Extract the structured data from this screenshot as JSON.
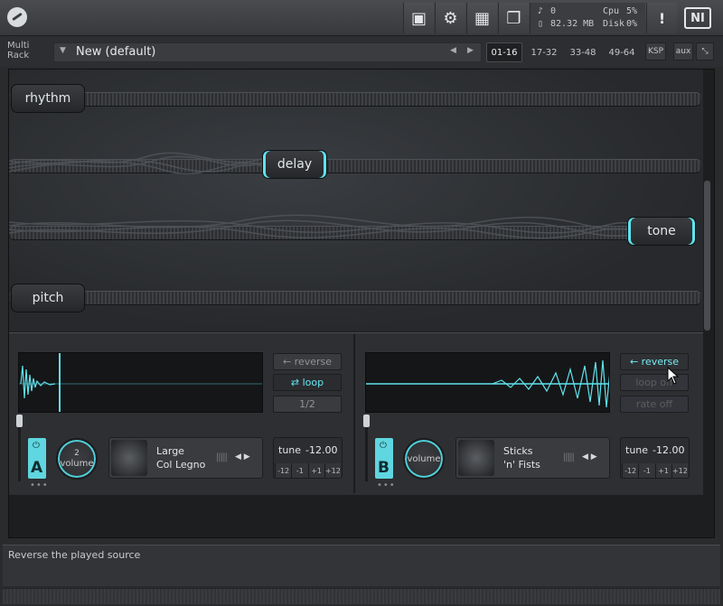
{
  "topbar": {
    "icons": [
      "kontakt-logo-icon",
      "save-icon",
      "gear-icon",
      "layout-icon",
      "window-icon",
      "warning-icon",
      "ni-logo-icon"
    ],
    "voices": "0",
    "memory": "82.32 MB",
    "cpu_label": "Cpu",
    "cpu_value": "5%",
    "disk_label": "Disk",
    "disk_value": "0%",
    "warning": "!",
    "ni_logo": "NI"
  },
  "rack": {
    "label_line1": "Multi",
    "label_line2": "Rack",
    "preset_name": "New (default)",
    "ranges": [
      "01-16",
      "17-32",
      "33-48",
      "49-64"
    ],
    "active_range": "01-16",
    "ksp": "KSP",
    "aux": "aux"
  },
  "visual": {
    "knots": [
      "rhythm",
      "delay",
      "tone",
      "pitch"
    ]
  },
  "slot_a": {
    "reverse": "← reverse",
    "loop": "⇄ loop",
    "rate": "1/2",
    "letter": "A",
    "knob_label": "volume",
    "knob_value": "2",
    "instrument_line1": "Large",
    "instrument_line2": "Col Legno",
    "tune_label": "tune",
    "tune_value": "-12.00",
    "tune_steps": [
      "-12",
      "-1",
      "+1",
      "+12"
    ]
  },
  "slot_b": {
    "reverse": "← reverse",
    "loop": "loop off",
    "rate": "rate off",
    "letter": "B",
    "knob_label": "volume",
    "instrument_line1": "Sticks",
    "instrument_line2": "'n' Fists",
    "tune_label": "tune",
    "tune_value": "-12.00",
    "tune_steps": [
      "-12",
      "-1",
      "+1",
      "+12"
    ]
  },
  "status": {
    "text": "Reverse the played source"
  },
  "colors": {
    "accent": "#5fe3ee",
    "background": "#2a2b2d"
  }
}
